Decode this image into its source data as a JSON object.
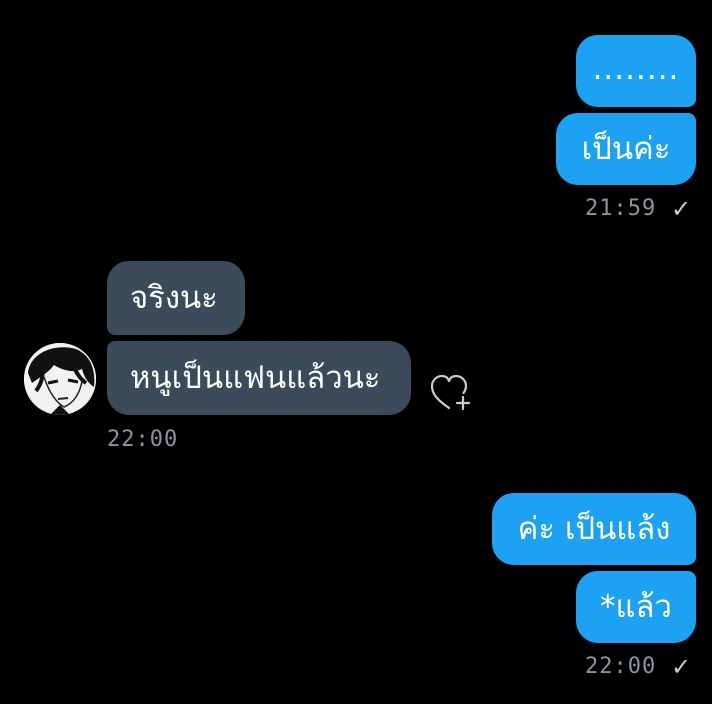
{
  "colors": {
    "background": "#000000",
    "outgoing_bubble": "#1da1f2",
    "incoming_bubble": "#3b4b5a",
    "timestamp": "#8a959f"
  },
  "messages": {
    "out1": {
      "text": "........"
    },
    "out2": {
      "text": "เป็นค่ะ"
    },
    "out_group1_time": "21:59",
    "out_group1_status": "✓",
    "in1": {
      "text": "จริงนะ"
    },
    "in2": {
      "text": "หนูเป็นแฟนแล้วนะ"
    },
    "in_group_time": "22:00",
    "out3": {
      "text": "ค่ะ เป็นแล้ง"
    },
    "out4": {
      "text": "*แล้ว"
    },
    "out_group2_time": "22:00",
    "out_group2_status": "✓"
  },
  "icons": {
    "avatar": "avatar-photo",
    "react": "heart-plus-icon",
    "read_receipt": "check-icon"
  }
}
